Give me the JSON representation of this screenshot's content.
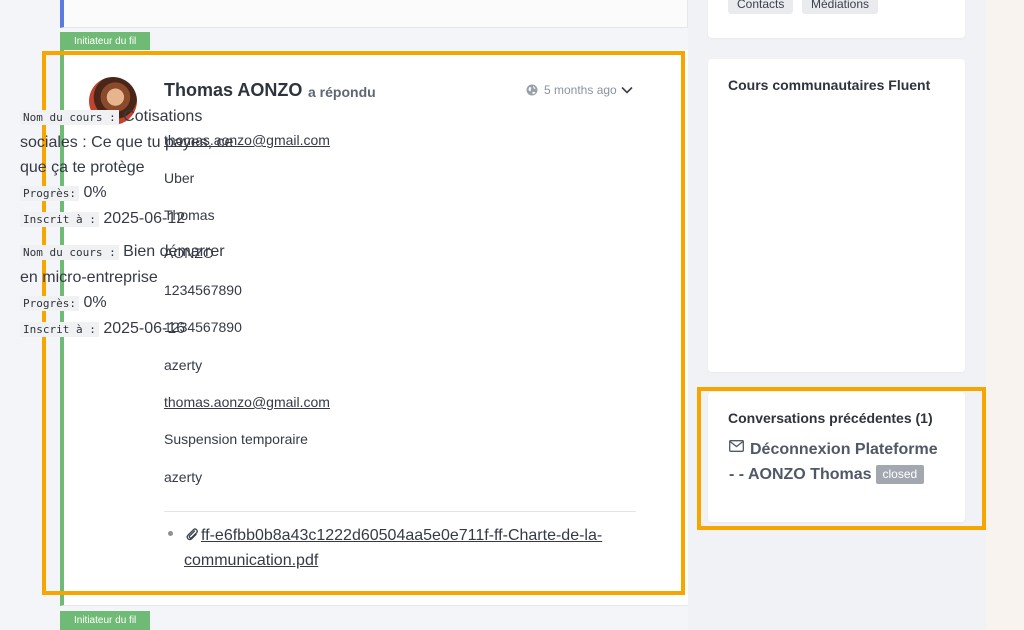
{
  "thread": {
    "initiator_tag": "Initiateur du fil",
    "message": {
      "author": "Thomas AONZO",
      "action": "a répondu",
      "time": "5 months ago",
      "fields": [
        {
          "text": "thomas.aonzo@gmail.com",
          "link": true
        },
        {
          "text": "Uber",
          "link": false
        },
        {
          "text": "Thomas",
          "link": false
        },
        {
          "text": "AONZO",
          "link": false
        },
        {
          "text": "1234567890",
          "link": false
        },
        {
          "text": "1234567890",
          "link": false
        },
        {
          "text": "azerty",
          "link": false
        },
        {
          "text": "thomas.aonzo@gmail.com",
          "link": true
        },
        {
          "text": "Suspension temporaire",
          "link": false
        },
        {
          "text": "azerty",
          "link": false
        }
      ],
      "attachment": "ff-e6fbb0b8a43c1222d60504aa5e0e711f-ff-Charte-de-la-communication.pdf"
    }
  },
  "sidebar": {
    "top_pills": [
      "Contacts",
      "Médiations"
    ],
    "courses": {
      "title": "Cours communautaires Fluent",
      "label_course": "Nom du cours :",
      "label_progress": "Progrès:",
      "label_enrolled": "Inscrit à :",
      "items": [
        {
          "name": "Cotisations sociales : Ce que tu payes, ce que ça te protège",
          "progress": "0%",
          "enrolled": "2025-06-12"
        },
        {
          "name": "Bien démarrer en micro-entreprise",
          "progress": "0%",
          "enrolled": "2025-06-16"
        }
      ]
    },
    "conversations": {
      "title": "Conversations précédentes (1)",
      "item_title": "Déconnexion Plateforme - - AONZO Thomas",
      "item_status": "closed"
    }
  },
  "colors": {
    "highlight": "#f7a600",
    "initiator_green": "#6fbb75",
    "prev_accent": "#5b7be0"
  },
  "icons": [
    "globe-icon",
    "chevron-down-icon",
    "paperclip-icon",
    "mail-icon"
  ]
}
